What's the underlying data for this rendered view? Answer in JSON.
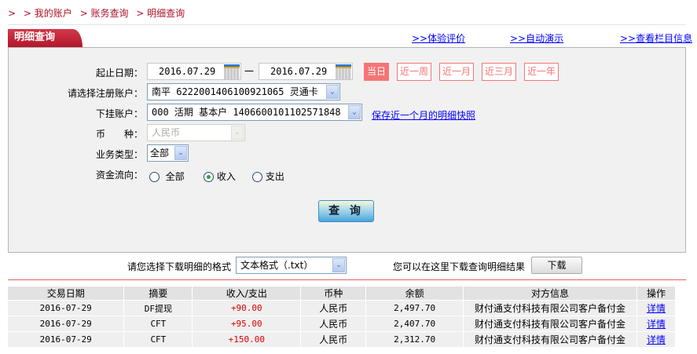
{
  "breadcrumb": {
    "prefix": ">",
    "items": [
      "> 我的账户",
      "> 账务查询",
      "> 明细查询"
    ]
  },
  "tab": {
    "title": "明细查询"
  },
  "top_links": [
    ">>体验评价",
    ">>自动演示",
    ">>查看栏目信息"
  ],
  "form": {
    "date_label": "起止日期：",
    "start_date": "2016.07.29",
    "date_sep": "一",
    "end_date": "2016.07.29",
    "quick_ranges": [
      {
        "label": "当日",
        "active": true
      },
      {
        "label": "近一周",
        "active": false
      },
      {
        "label": "近一月",
        "active": false
      },
      {
        "label": "近三月",
        "active": false
      },
      {
        "label": "近一年",
        "active": false
      }
    ],
    "account_label": "请选择注册账户：",
    "account_value": "南平 6222001406100921065 灵通卡",
    "sub_account_label": "下挂账户：",
    "sub_account_value": "000 活期 基本户 1406600101102571848",
    "snapshot_link": "保存近一个月的明细快照",
    "currency_label": "币　　种：",
    "currency_value": "人民币",
    "biz_type_label": "业务类型：",
    "biz_type_value": "全部",
    "flow_label": "资金流向：",
    "flow_options": [
      {
        "label": "全部",
        "checked": false
      },
      {
        "label": "收入",
        "checked": true
      },
      {
        "label": "支出",
        "checked": false
      }
    ],
    "query_button": "查 询"
  },
  "download": {
    "format_label": "请您选择下载明细的格式",
    "format_value": "文本格式（.txt）",
    "hint": "您可以在这里下载查询明细结果",
    "button": "下载"
  },
  "colors": {
    "brand": "#b3162b",
    "quick_range": "#f47575",
    "amount": "#dd0000",
    "link": "#0000ff"
  },
  "table": {
    "headers": [
      "交易日期",
      "摘要",
      "收入/支出",
      "币种",
      "余额",
      "对方信息",
      "操作"
    ],
    "rows": [
      [
        "2016-07-29",
        "DF提现",
        "+90.00",
        "人民币",
        "2,497.70",
        "财付通支付科技有限公司客户备付金",
        "详情"
      ],
      [
        "2016-07-29",
        "CFT",
        "+95.00",
        "人民币",
        "2,407.70",
        "财付通支付科技有限公司客户备付金",
        "详情"
      ],
      [
        "2016-07-29",
        "CFT",
        "+150.00",
        "人民币",
        "2,312.70",
        "财付通支付科技有限公司客户备付金",
        "详情"
      ]
    ]
  }
}
